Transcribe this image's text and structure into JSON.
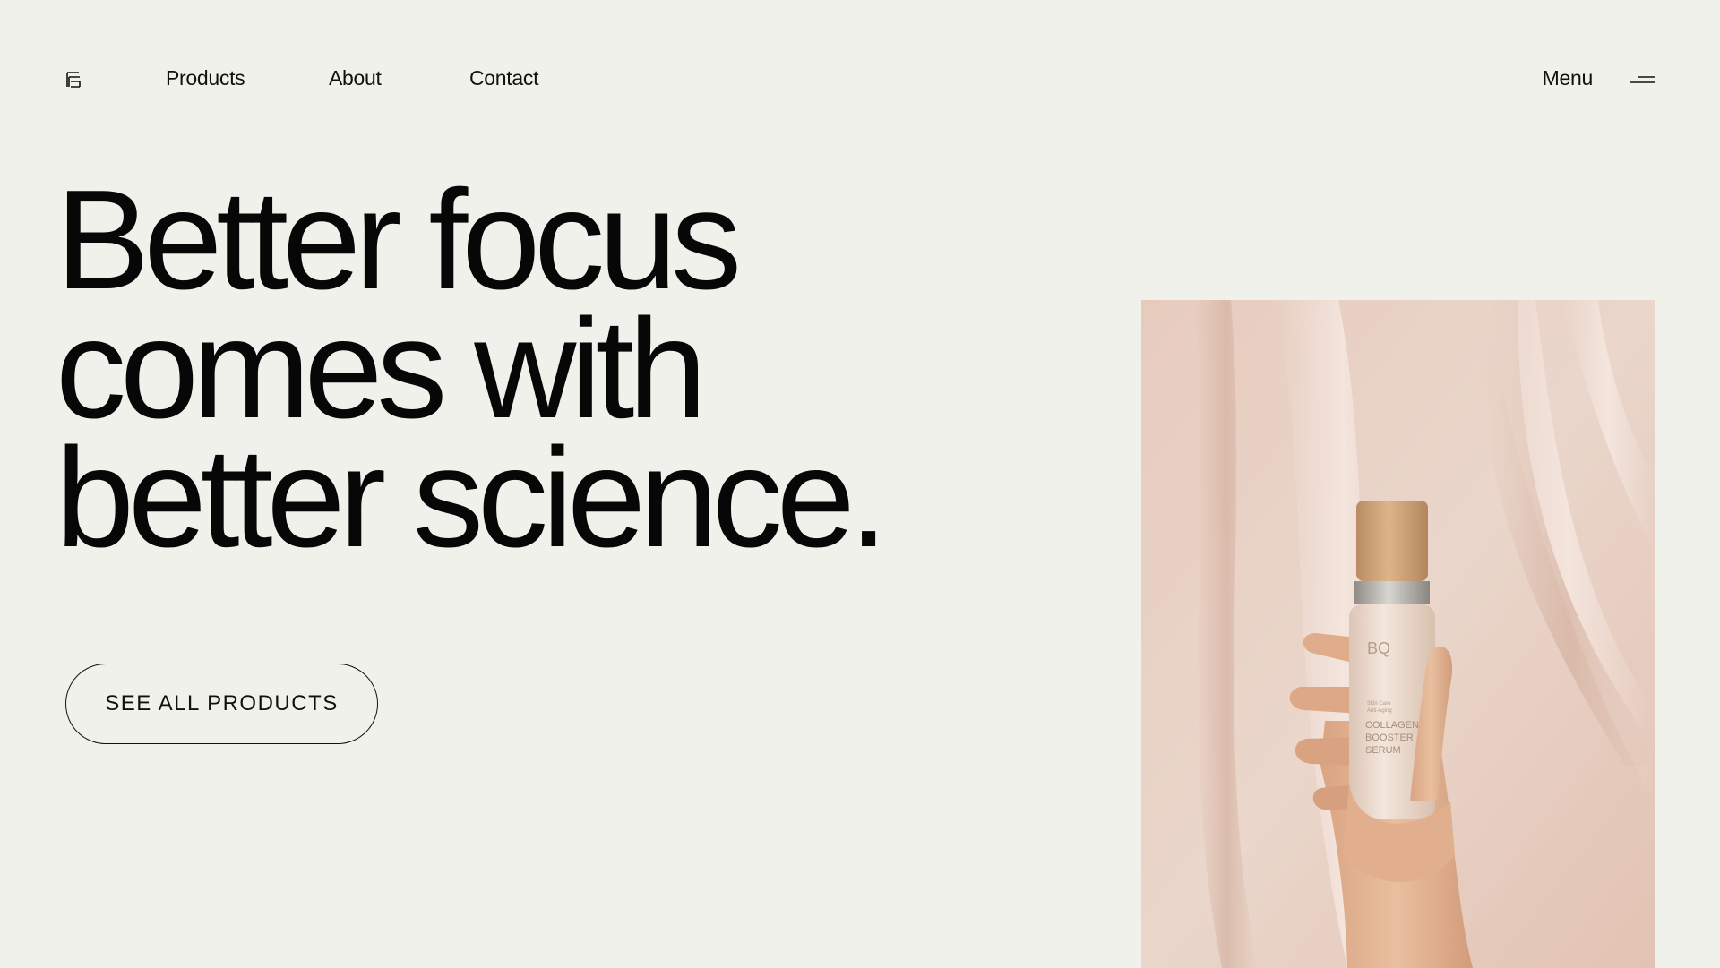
{
  "header": {
    "logo_icon": "brand-mark-icon",
    "nav": [
      {
        "label": "Products"
      },
      {
        "label": "About"
      },
      {
        "label": "Contact"
      }
    ],
    "menu_label": "Menu",
    "menu_icon": "hamburger-icon"
  },
  "hero": {
    "headline_lines": [
      "Better focus",
      "comes with",
      "better science."
    ],
    "cta_label": "SEE ALL PRODUCTS"
  },
  "product_image": {
    "bottle_brand": "BQ",
    "bottle_small_text": [
      "Skin Care",
      "Anti-Aging"
    ],
    "bottle_product_name": [
      "COLLAGEN",
      "BOOSTER",
      "SERUM"
    ]
  },
  "colors": {
    "background": "#f1f1ec",
    "text": "#0c0c0c",
    "photo_bg": "#e8cfc2",
    "bottle": "#efe0d3",
    "cap_wood": "#d2a77a",
    "collar_silver": "#b8b5b0",
    "skin": "#e2b494"
  }
}
